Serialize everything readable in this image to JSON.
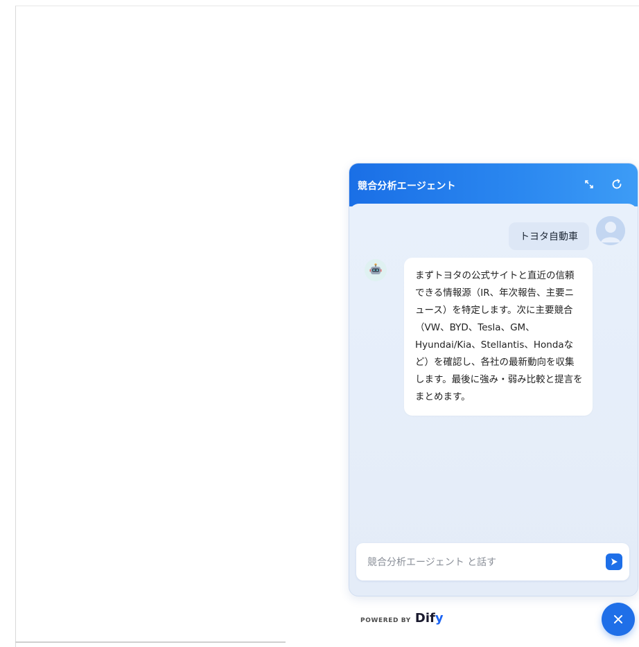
{
  "chat": {
    "title": "競合分析エージェント",
    "user_message": "トヨタ自動車",
    "bot_message": "まずトヨタの公式サイトと直近の信頼できる情報源（IR、年次報告、主要ニュース）を特定します。次に主要競合（VW、BYD、Tesla、GM、Hyundai/Kia、Stellantis、Hondaなど）を確認し、各社の最新動向を収集します。最後に強み・弱み比較と提言をまとめます。",
    "input_placeholder": "競合分析エージェント と話す",
    "icons": {
      "expand": "expand-icon",
      "refresh": "refresh-icon",
      "send": "send-icon",
      "close": "close-icon",
      "user": "user-avatar-icon",
      "bot": "robot-avatar-icon"
    }
  },
  "footer": {
    "powered_label": "POWERED BY",
    "brand_prefix": "Dif",
    "brand_suffix": "y"
  },
  "colors": {
    "accent": "#1f6fe8",
    "header_gradient_start": "#1a6fe6",
    "header_gradient_end": "#3d9cf6"
  }
}
